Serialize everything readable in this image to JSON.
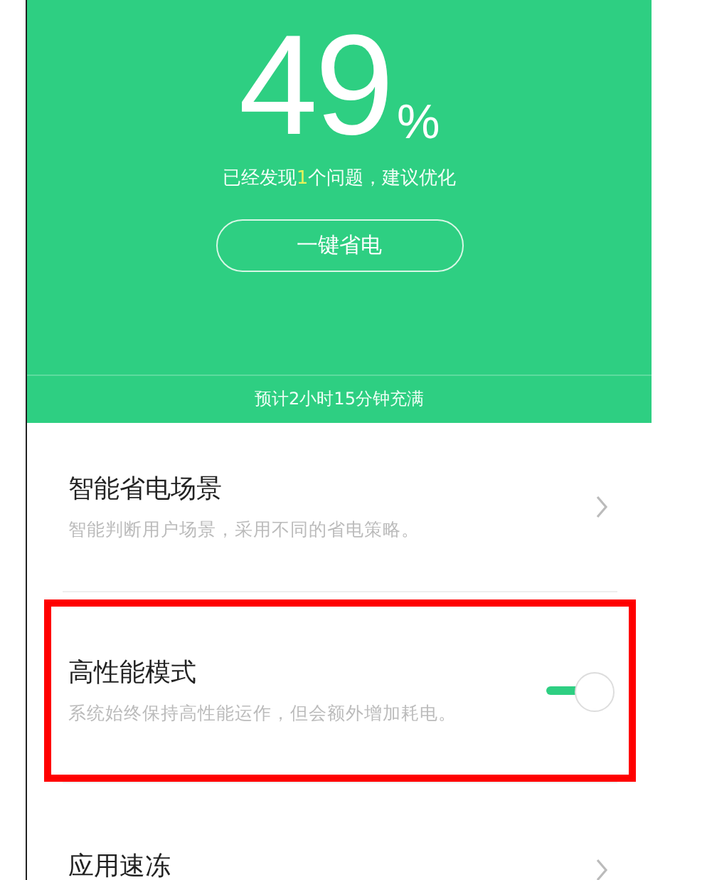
{
  "battery": {
    "percent": "49",
    "unit": "%",
    "issue_before": "已经发现",
    "issue_count": "1",
    "issue_after": "个问题，建议优化",
    "button": "一键省电",
    "charge_estimate": "预计2小时15分钟充满"
  },
  "settings": [
    {
      "kind": "link",
      "title": "智能省电场景",
      "description": "智能判断用户场景，采用不同的省电策略。",
      "highlighted": false
    },
    {
      "kind": "toggle",
      "title": "高性能模式",
      "description": "系统始终保持高性能运作，但会额外增加耗电。",
      "on": true,
      "highlighted": true
    },
    {
      "kind": "link",
      "title": "应用速冻",
      "highlighted": false
    }
  ]
}
